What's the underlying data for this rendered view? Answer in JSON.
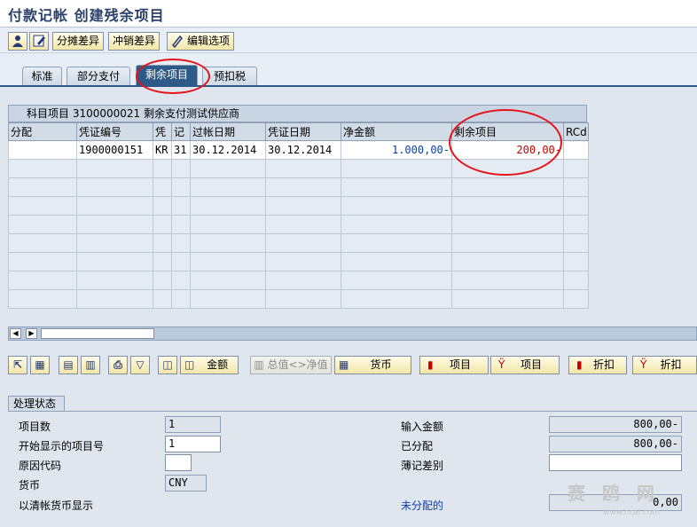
{
  "window": {
    "title": "付款记帐 创建残余项目"
  },
  "toolbar": {
    "user_icon": "user-icon",
    "edit_icon": "edit-icon",
    "split_diff_label": "分摊差异",
    "writeoff_diff_label": "冲销差异",
    "edit_options_label": "编辑选项"
  },
  "tabs": [
    {
      "label": "标准"
    },
    {
      "label": "部分支付"
    },
    {
      "label": "剩余项目"
    },
    {
      "label": "预扣税"
    }
  ],
  "table": {
    "title": "科目项目 3100000021 剩余支付测试供应商",
    "columns": [
      "分配",
      "凭证编号",
      "凭",
      "记",
      "过帐日期",
      "凭证日期",
      "净金额",
      "剩余项目",
      "RCd"
    ],
    "rows": [
      [
        "",
        "1900000151",
        "KR",
        "31",
        "30.12.2014",
        "30.12.2014",
        "1.000,00-",
        "200,00-",
        ""
      ]
    ]
  },
  "bottom_buttons": {
    "amount_label": "金额",
    "gross_net_label": "总值<>净值",
    "currency_label": "货币",
    "item_label_1": "项目",
    "item_label_2": "项目",
    "discount_label_1": "折扣",
    "discount_label_2": "折扣"
  },
  "status": {
    "group_label": "处理状态",
    "item_count_label": "项目数",
    "item_count_value": "1",
    "first_item_label": "开始显示的项目号",
    "first_item_value": "1",
    "reason_code_label": "原因代码",
    "reason_code_value": "",
    "currency_label": "货币",
    "currency_value": "CNY",
    "clearing_currency_label": "以清帐货币显示",
    "entered_amount_label": "输入金额",
    "entered_amount_value": "800,00-",
    "assigned_label": "已分配",
    "assigned_value": "800,00-",
    "posting_diff_label": "薄记差别",
    "posting_diff_value": "",
    "unassigned_label": "未分配的",
    "unassigned_value": "0,00"
  },
  "watermark": {
    "text": "赛 鸥 网",
    "sub": "www.ccai.com"
  },
  "colors": {
    "accent": "#2d5a86",
    "highlight_red": "#e3141a",
    "amount_blue": "#0b3fa8",
    "amount_red": "#c00000"
  }
}
